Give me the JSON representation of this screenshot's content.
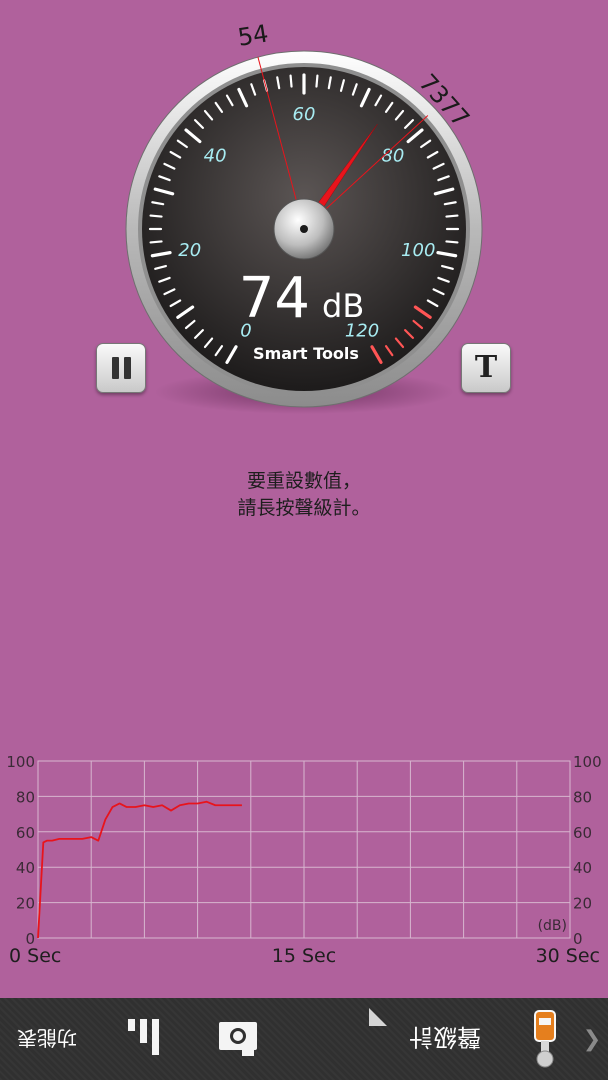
{
  "meter": {
    "brand": "Smart Tools",
    "value": "74",
    "unit": "dB",
    "min_marker": "54",
    "max_marker": "7377",
    "scale_labels": [
      "0",
      "20",
      "40",
      "60",
      "80",
      "100",
      "120"
    ]
  },
  "controls": {
    "pause_icon": "pause-icon",
    "text_icon": "T"
  },
  "hint": {
    "line1": "要重設數值，",
    "line2": "請長按聲級計。"
  },
  "graph": {
    "y_ticks": [
      "100",
      "80",
      "60",
      "40",
      "20",
      "0"
    ],
    "unit_label": "(dB)",
    "x_labels": [
      "0 Sec",
      "15 Sec",
      "30 Sec"
    ]
  },
  "chart_data": {
    "type": "line",
    "xlabel": "",
    "ylabel": "",
    "ylim": [
      0,
      100
    ],
    "xlim": [
      0,
      30
    ],
    "x_tick_labels": [
      "0 Sec",
      "15 Sec",
      "30 Sec"
    ],
    "y_tick_labels": [
      "0",
      "20",
      "40",
      "60",
      "80",
      "100"
    ],
    "series": [
      {
        "color": "#e8141c",
        "x": [
          0.0,
          0.3,
          0.5,
          0.8,
          1.2,
          1.6,
          2.0,
          2.5,
          3.0,
          3.4,
          3.8,
          4.2,
          4.6,
          5.0,
          5.5,
          6.0,
          6.5,
          7.0,
          7.5,
          8.0,
          8.5,
          9.0,
          9.5,
          10.0,
          10.5,
          11.0,
          11.5
        ],
        "values": [
          0,
          54,
          55,
          55,
          56,
          56,
          56,
          56,
          57,
          55,
          67,
          74,
          76,
          74,
          74,
          75,
          74,
          75,
          72,
          75,
          76,
          76,
          77,
          75,
          75,
          75,
          75
        ]
      }
    ]
  },
  "bottom_bar": {
    "function_table": "功能表",
    "decibel_meter": "聲級計",
    "chevron_icon": "chevron-right-icon",
    "chevron_glyph": "❯"
  },
  "colors": {
    "background": "#b0619c",
    "needle": "#e8141c",
    "scale_numbers": "#a8ecf2",
    "warning_ticks": "#ff5555"
  }
}
